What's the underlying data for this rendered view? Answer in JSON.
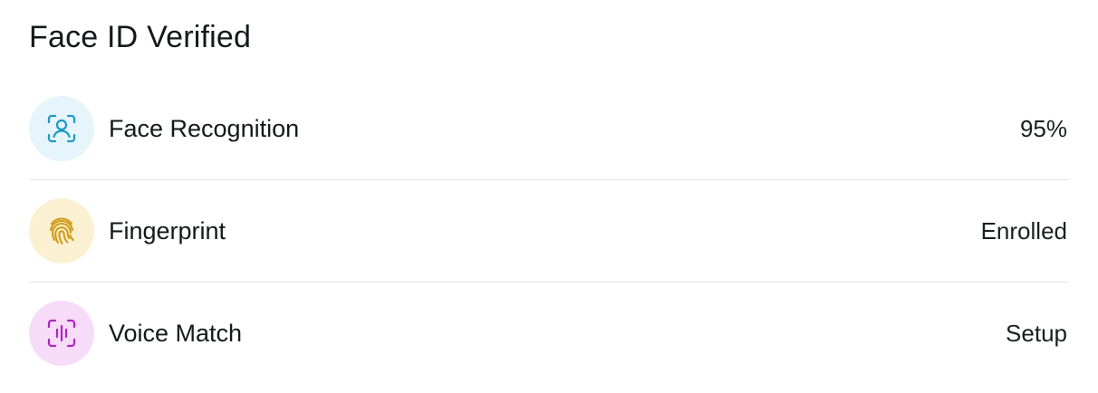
{
  "card": {
    "title": "Face ID Verified"
  },
  "methods": [
    {
      "label": "Face Recognition",
      "value": "95%",
      "icon": "face-scan-icon",
      "icon_color": "#1a9cc4",
      "icon_bg": "#e6f4fb"
    },
    {
      "label": "Fingerprint",
      "value": "Enrolled",
      "icon": "fingerprint-icon",
      "icon_color": "#d19a18",
      "icon_bg": "#fbf1d2"
    },
    {
      "label": "Voice Match",
      "value": "Setup",
      "icon": "voice-scan-icon",
      "icon_color": "#b221c9",
      "icon_bg": "#f7dcfa"
    }
  ]
}
